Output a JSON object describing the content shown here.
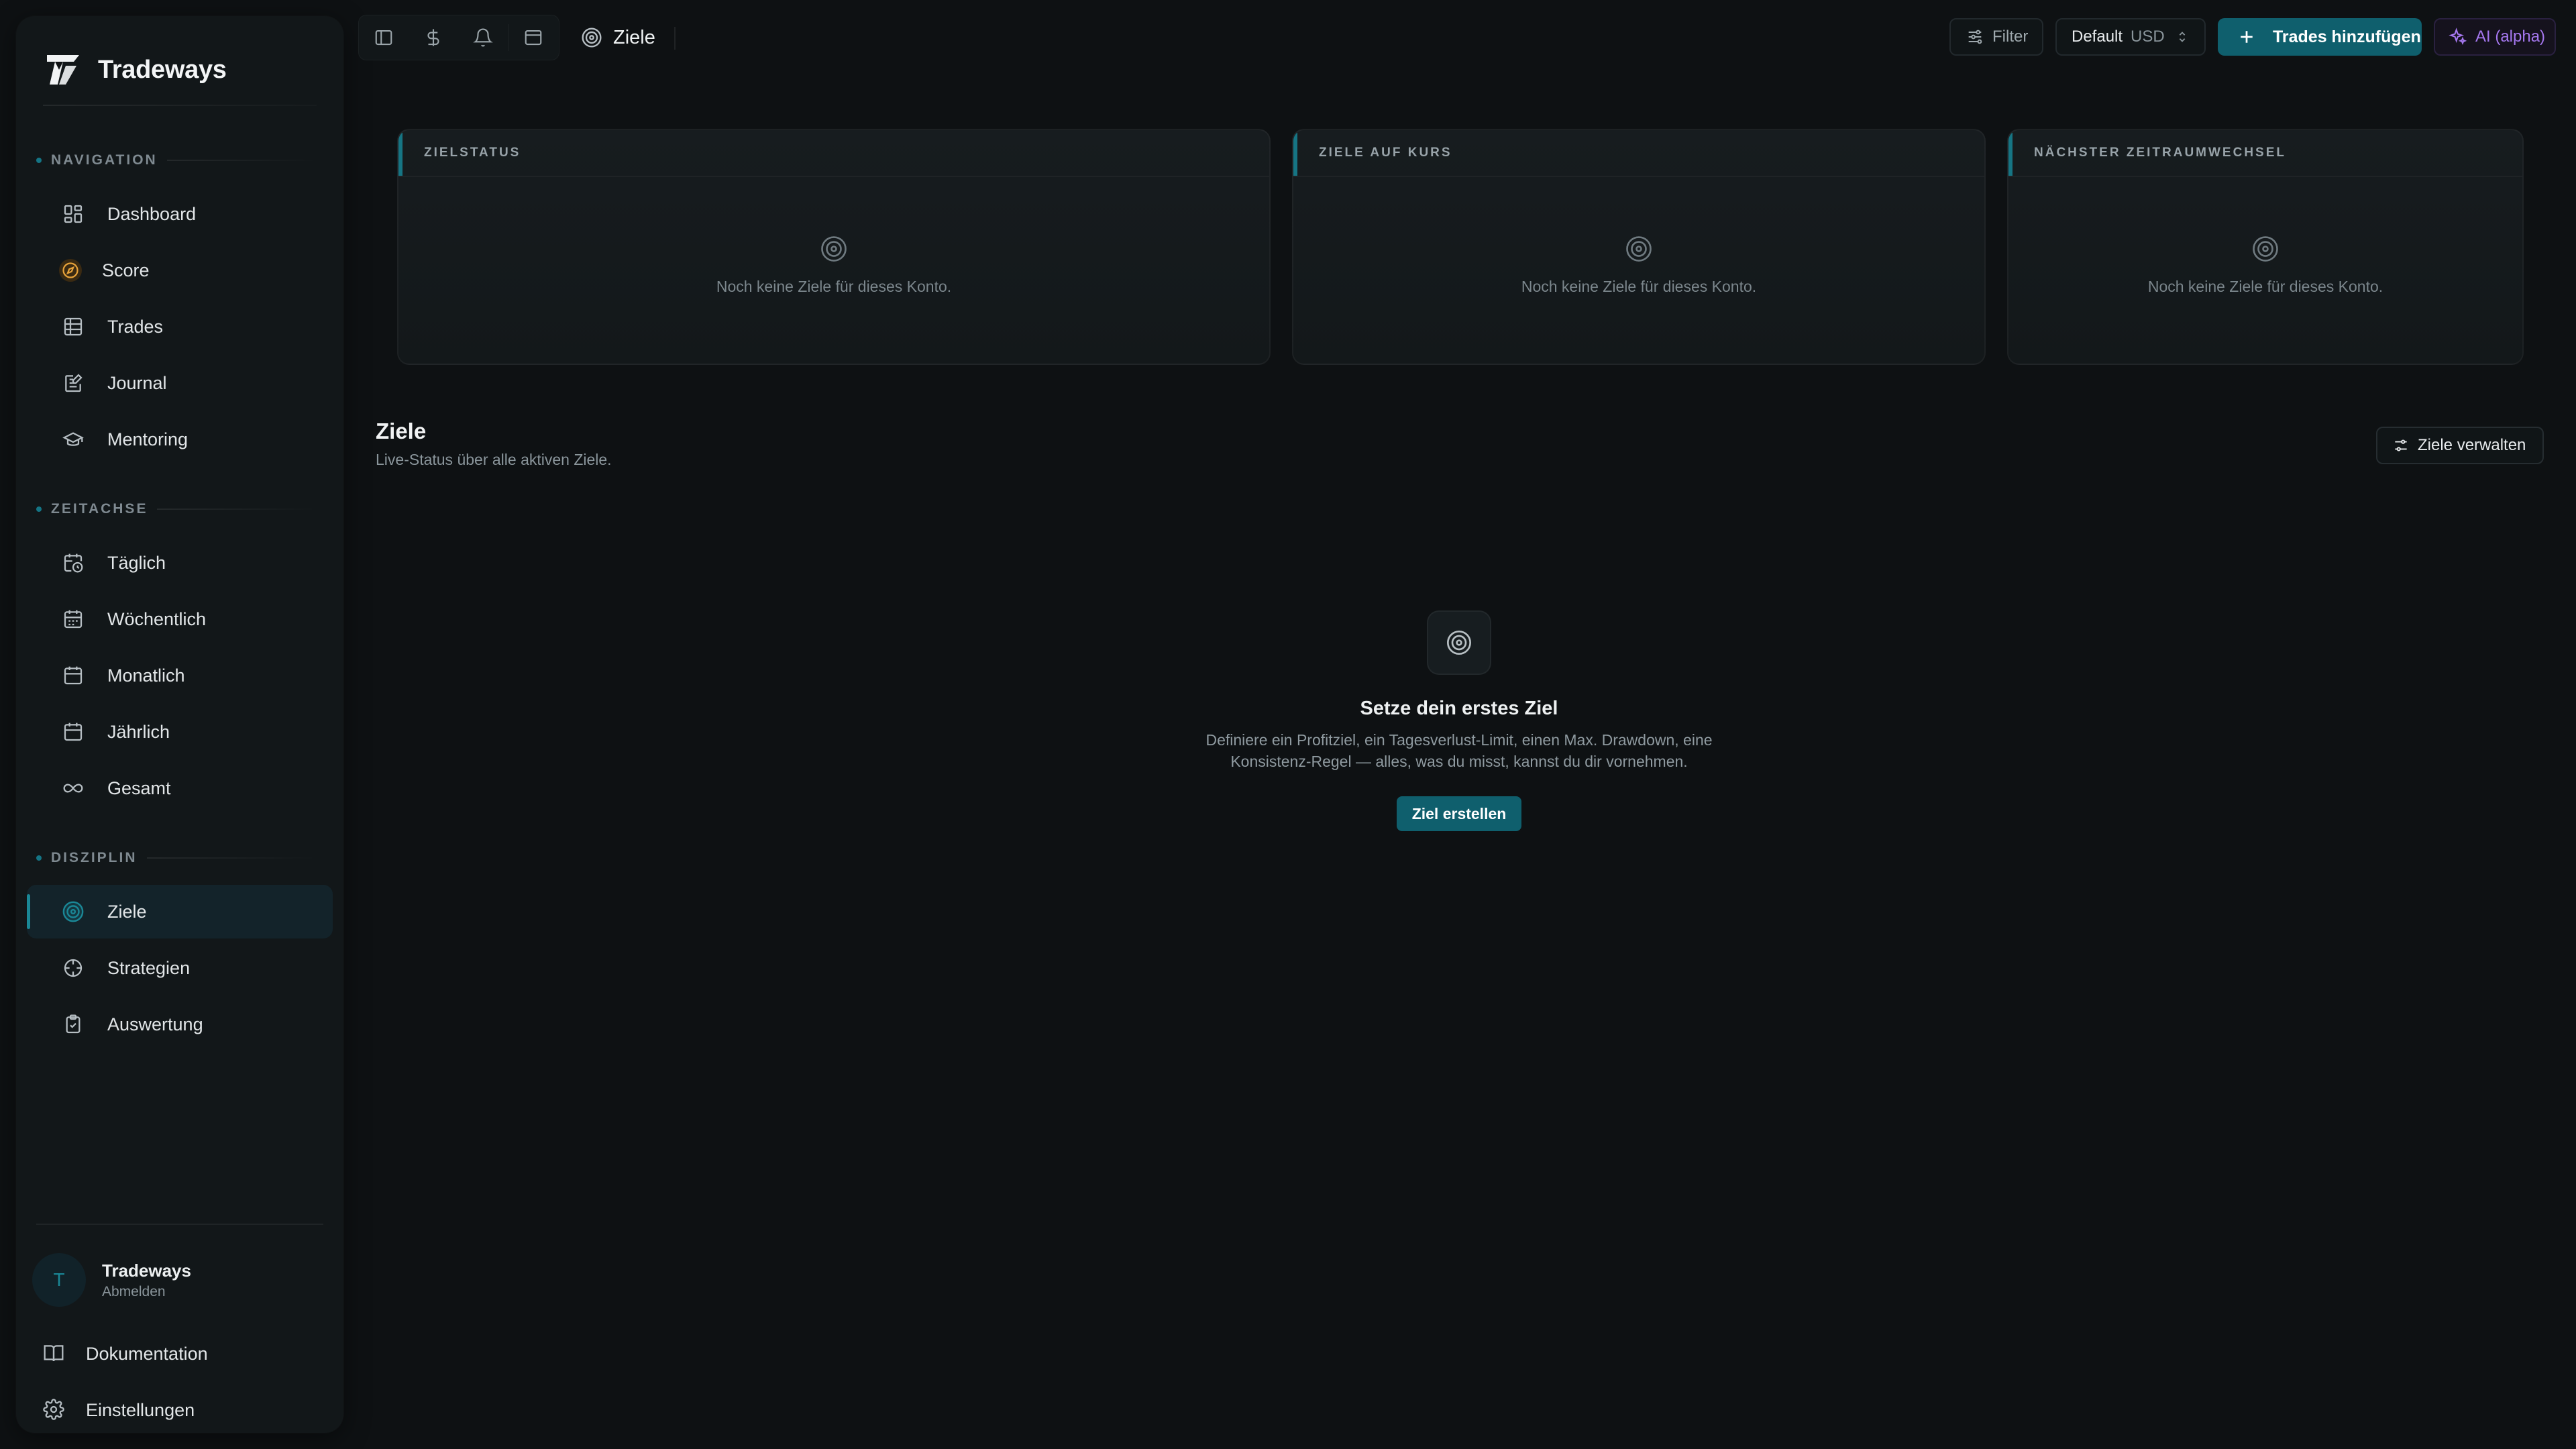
{
  "brand": {
    "name": "Tradeways",
    "logo_icon": "tradeways-logo-icon"
  },
  "sidebar": {
    "sections": {
      "navigation": "NAVIGATION",
      "timeline": "ZEITACHSE",
      "discipline": "DISZIPLIN"
    },
    "navigation": [
      {
        "label": "Dashboard",
        "icon": "dashboard-icon"
      },
      {
        "label": "Score",
        "icon": "compass-icon"
      },
      {
        "label": "Trades",
        "icon": "table-icon"
      },
      {
        "label": "Journal",
        "icon": "journal-icon"
      },
      {
        "label": "Mentoring",
        "icon": "graduation-cap-icon"
      }
    ],
    "timeline": [
      {
        "label": "Täglich",
        "icon": "calendar-clock-icon"
      },
      {
        "label": "Wöchentlich",
        "icon": "calendar-days-icon"
      },
      {
        "label": "Monatlich",
        "icon": "calendar-grid-icon"
      },
      {
        "label": "Jährlich",
        "icon": "calendar-icon"
      },
      {
        "label": "Gesamt",
        "icon": "infinity-icon"
      }
    ],
    "discipline": [
      {
        "label": "Ziele",
        "icon": "target-icon",
        "active": true
      },
      {
        "label": "Strategien",
        "icon": "crosshair-icon"
      },
      {
        "label": "Auswertung",
        "icon": "clipboard-check-icon"
      }
    ],
    "user": {
      "initial": "T",
      "name": "Tradeways",
      "action": "Abmelden"
    },
    "footer": [
      {
        "label": "Dokumentation",
        "icon": "book-open-icon"
      },
      {
        "label": "Einstellungen",
        "icon": "gear-icon"
      }
    ]
  },
  "topbar": {
    "breadcrumb": "Ziele",
    "filter_label": "Filter",
    "account": {
      "name": "Default",
      "currency": "USD"
    },
    "add_trades_label": "Trades hinzufügen",
    "ai_label": "AI (alpha)"
  },
  "cards": [
    {
      "title": "ZIELSTATUS",
      "empty_text": "Noch keine Ziele für dieses Konto."
    },
    {
      "title": "ZIELE AUF KURS",
      "empty_text": "Noch keine Ziele für dieses Konto."
    },
    {
      "title": "NÄCHSTER ZEITRAUMWECHSEL",
      "empty_text": "Noch keine Ziele für dieses Konto."
    }
  ],
  "goals": {
    "title": "Ziele",
    "subtitle": "Live-Status über alle aktiven Ziele.",
    "manage_label": "Ziele verwalten",
    "empty_title": "Setze dein erstes Ziel",
    "empty_desc_line1": "Definiere ein Profitziel, ein Tagesverlust-Limit, einen Max. Drawdown, eine",
    "empty_desc_line2": "Konsistenz-Regel — alles, was du misst, kannst du dir vornehmen.",
    "create_label": "Ziel erstellen"
  },
  "colors": {
    "accent": "#0f5f6d",
    "accent_bright": "#1a8796",
    "score_orange": "#e8a33a",
    "ai_purple": "#a678f0"
  }
}
